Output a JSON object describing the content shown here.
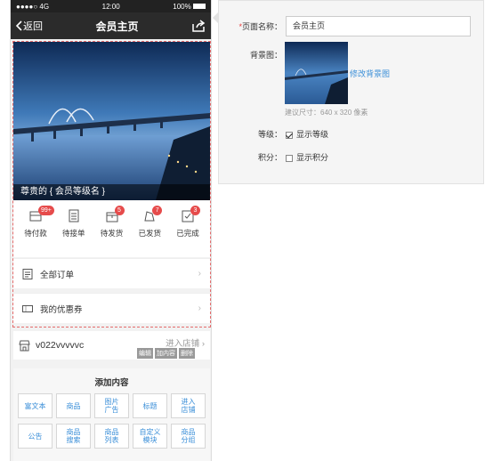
{
  "status_bar": {
    "carrier": "●●●●○ 4G",
    "time": "12:00",
    "battery": "100%"
  },
  "titlebar": {
    "back_label": "返回",
    "title": "会员主页"
  },
  "banner": {
    "member_text": "尊贵的 { 会员等级名 }"
  },
  "orders": [
    {
      "label": "待付款",
      "badge": "99+",
      "icon": "wallet-icon"
    },
    {
      "label": "待接单",
      "badge": "",
      "icon": "clipboard-icon"
    },
    {
      "label": "待发货",
      "badge": "5",
      "icon": "box-icon"
    },
    {
      "label": "已发货",
      "badge": "7",
      "icon": "truck-icon"
    },
    {
      "label": "已完成",
      "badge": "3",
      "icon": "check-box-icon"
    }
  ],
  "rows": {
    "all_orders": "全部订单",
    "coupons": "我的优惠券"
  },
  "shop": {
    "name": "v022vvvvvc",
    "enter": "进入店铺",
    "actions": [
      "编辑",
      "加内容",
      "删除"
    ]
  },
  "add_panel": {
    "title": "添加内容",
    "buttons": [
      "富文本",
      "商品",
      "图片\n广告",
      "标题",
      "进入\n店铺",
      "公告",
      "商品\n搜索",
      "商品\n列表",
      "自定义\n模块",
      "商品\n分组"
    ]
  },
  "form": {
    "page_name_label": "页面名称：",
    "page_name_value": "会员主页",
    "bg_label": "背景图：",
    "modify_bg": "修改背景图",
    "size_hint": "建议尺寸：640 x 320 像素",
    "level_label": "等级：",
    "level_option": "显示等级",
    "level_checked": true,
    "points_label": "积分：",
    "points_option": "显示积分",
    "points_checked": false
  },
  "colors": {
    "accent": "#3b8fd8",
    "badge": "#e64b4b",
    "dashed_border": "#e46b6b"
  }
}
